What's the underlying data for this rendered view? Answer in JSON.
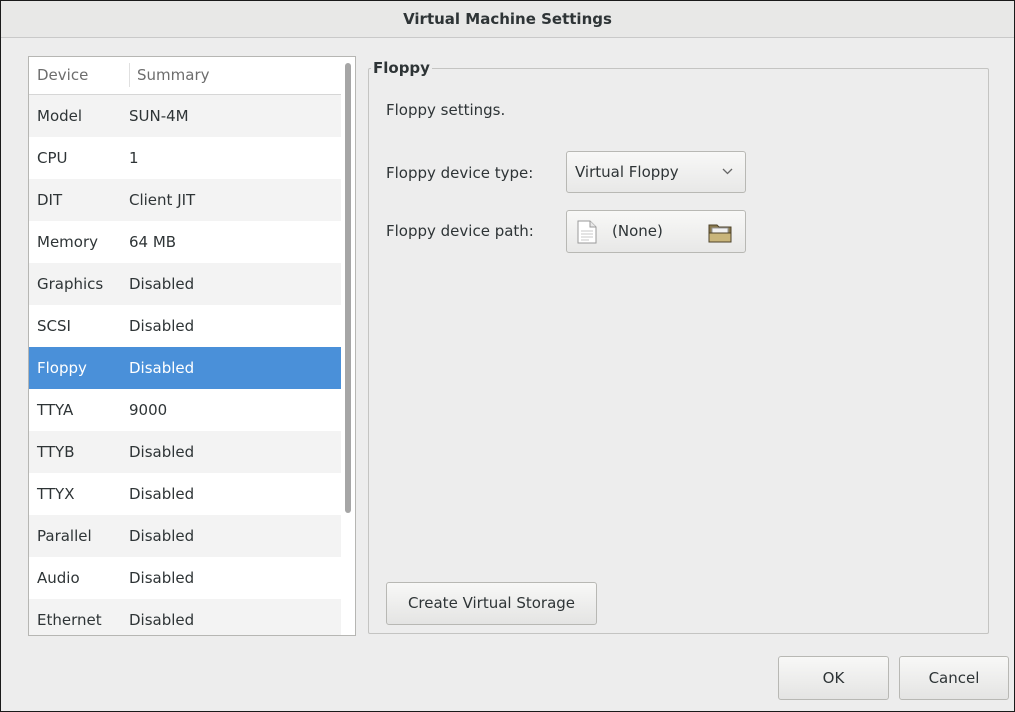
{
  "window": {
    "title": "Virtual Machine Settings"
  },
  "device_list": {
    "columns": [
      "Device",
      "Summary"
    ],
    "rows": [
      {
        "device": "Model",
        "summary": "SUN-4M"
      },
      {
        "device": "CPU",
        "summary": "1"
      },
      {
        "device": "DIT",
        "summary": "Client JIT"
      },
      {
        "device": "Memory",
        "summary": "64 MB"
      },
      {
        "device": "Graphics",
        "summary": "Disabled"
      },
      {
        "device": "SCSI",
        "summary": "Disabled"
      },
      {
        "device": "Floppy",
        "summary": "Disabled"
      },
      {
        "device": "TTYA",
        "summary": "9000"
      },
      {
        "device": "TTYB",
        "summary": "Disabled"
      },
      {
        "device": "TTYX",
        "summary": "Disabled"
      },
      {
        "device": "Parallel",
        "summary": "Disabled"
      },
      {
        "device": "Audio",
        "summary": "Disabled"
      },
      {
        "device": "Ethernet",
        "summary": "Disabled"
      }
    ],
    "selected": "Floppy"
  },
  "floppy_panel": {
    "title": "Floppy",
    "description": "Floppy settings.",
    "device_type_label": "Floppy device type:",
    "device_type_value": "Virtual Floppy",
    "device_path_label": "Floppy device path:",
    "device_path_value": "(None)",
    "create_storage_label": "Create Virtual Storage"
  },
  "dialog_buttons": {
    "ok": "OK",
    "cancel": "Cancel"
  },
  "colors": {
    "selection": "#4a90d9",
    "background": "#ededed"
  },
  "icons": [
    "document-icon",
    "folder-icon",
    "chevron-down-icon"
  ]
}
